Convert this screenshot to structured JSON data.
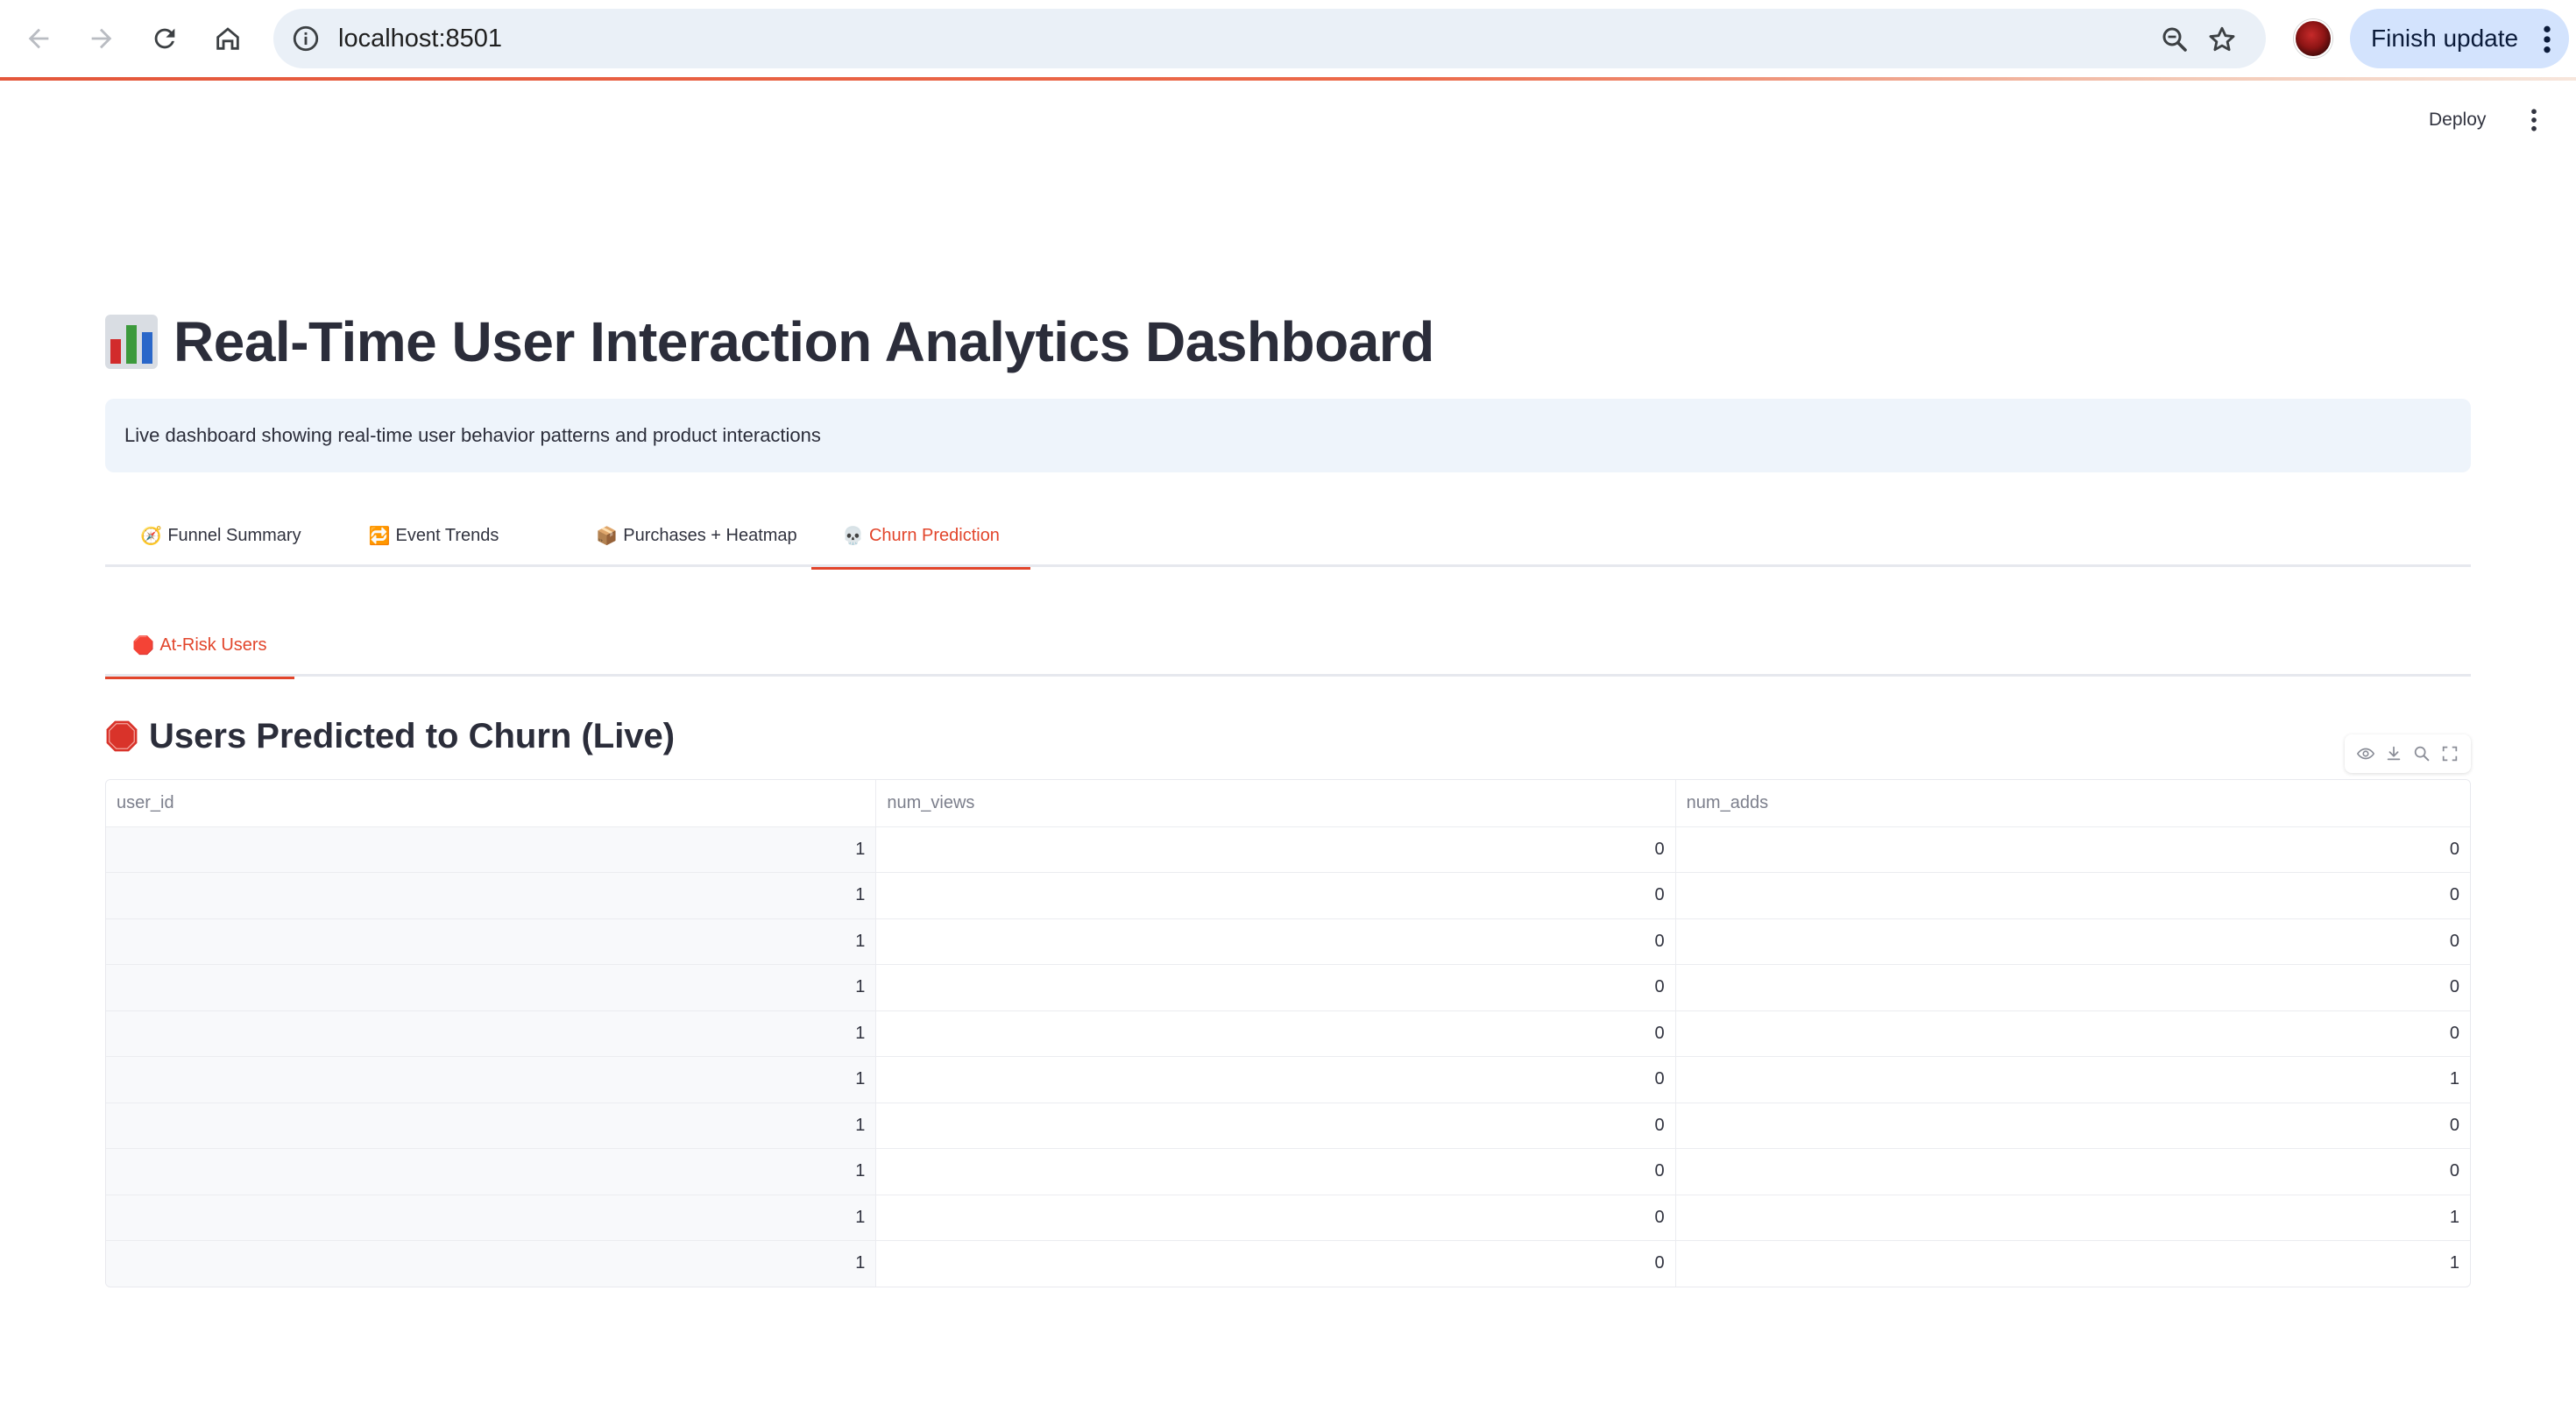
{
  "browser": {
    "url": "localhost:8501",
    "finish_update_label": "Finish update"
  },
  "app_header": {
    "deploy_label": "Deploy"
  },
  "page": {
    "title": "Real-Time User Interaction Analytics Dashboard",
    "info_text": "Live dashboard showing real-time user behavior patterns and product interactions"
  },
  "tabs": [
    {
      "emoji": "🧭",
      "label": "Funnel Summary",
      "active": false
    },
    {
      "emoji": "🔁",
      "label": "Event Trends",
      "active": false
    },
    {
      "emoji": "📦",
      "label": "Purchases + Heatmap",
      "active": false
    },
    {
      "emoji": "💀",
      "label": "Churn Prediction",
      "active": true
    }
  ],
  "subtabs": [
    {
      "emoji": "🛑",
      "label": "At-Risk Users",
      "active": true
    }
  ],
  "section": {
    "title": "Users Predicted to Churn (Live)"
  },
  "table": {
    "columns": [
      "user_id",
      "num_views",
      "num_adds"
    ],
    "rows": [
      [
        "1",
        "0",
        "0"
      ],
      [
        "1",
        "0",
        "0"
      ],
      [
        "1",
        "0",
        "0"
      ],
      [
        "1",
        "0",
        "0"
      ],
      [
        "1",
        "0",
        "0"
      ],
      [
        "1",
        "0",
        "1"
      ],
      [
        "1",
        "0",
        "0"
      ],
      [
        "1",
        "0",
        "0"
      ],
      [
        "1",
        "0",
        "1"
      ],
      [
        "1",
        "0",
        "1"
      ]
    ]
  },
  "colors": {
    "accent": "#e2452b",
    "info_bg": "#eef4fb",
    "text": "#31333f"
  },
  "icons": {
    "toolbar": [
      "eye-icon",
      "download-icon",
      "search-icon",
      "fullscreen-icon"
    ]
  }
}
